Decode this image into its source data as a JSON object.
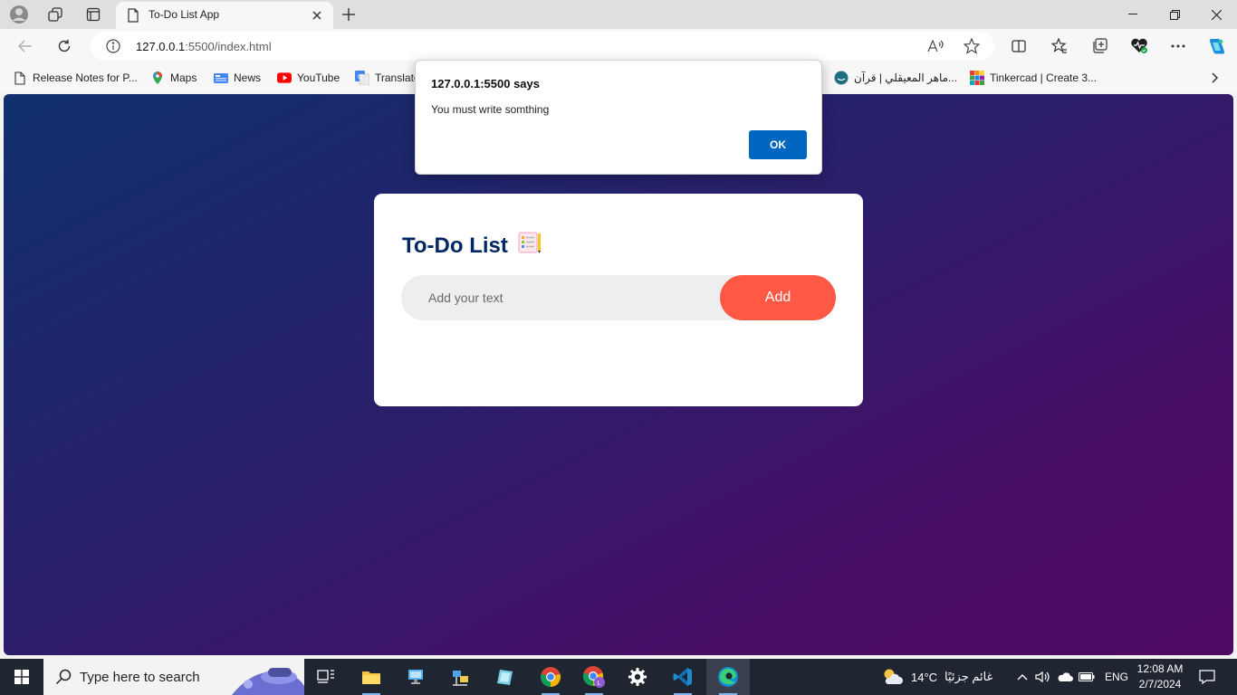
{
  "browser": {
    "tab": {
      "title": "To-Do List App"
    },
    "address": {
      "url_host": "127.0.0.1",
      "url_rest": ":5500/index.html"
    },
    "bookmarks": [
      {
        "label": "Release Notes for P...",
        "icon": "document-icon"
      },
      {
        "label": "Maps",
        "icon": "maps-icon"
      },
      {
        "label": "News",
        "icon": "news-icon"
      },
      {
        "label": "YouTube",
        "icon": "youtube-icon"
      },
      {
        "label": "Translate",
        "icon": "translate-icon"
      },
      {
        "label": "ماهر المعيقلي | قرآن...",
        "icon": "quran-site-icon"
      },
      {
        "label": "Tinkercad | Create 3...",
        "icon": "tinkercad-icon"
      }
    ]
  },
  "app": {
    "title": "To-Do List",
    "input_placeholder": "Add your text",
    "add_label": "Add",
    "colors": {
      "title": "#002765",
      "button": "#ff5945",
      "input_bg": "#edeef0"
    }
  },
  "dialog": {
    "title": "127.0.0.1:5500 says",
    "message": "You must write somthing",
    "ok_label": "OK"
  },
  "taskbar": {
    "search_placeholder": "Type here to search",
    "weather": {
      "temp": "14°C",
      "condition": "غائم جزئيًا"
    },
    "language": "ENG",
    "time": "12:08 AM",
    "date": "2/7/2024"
  }
}
